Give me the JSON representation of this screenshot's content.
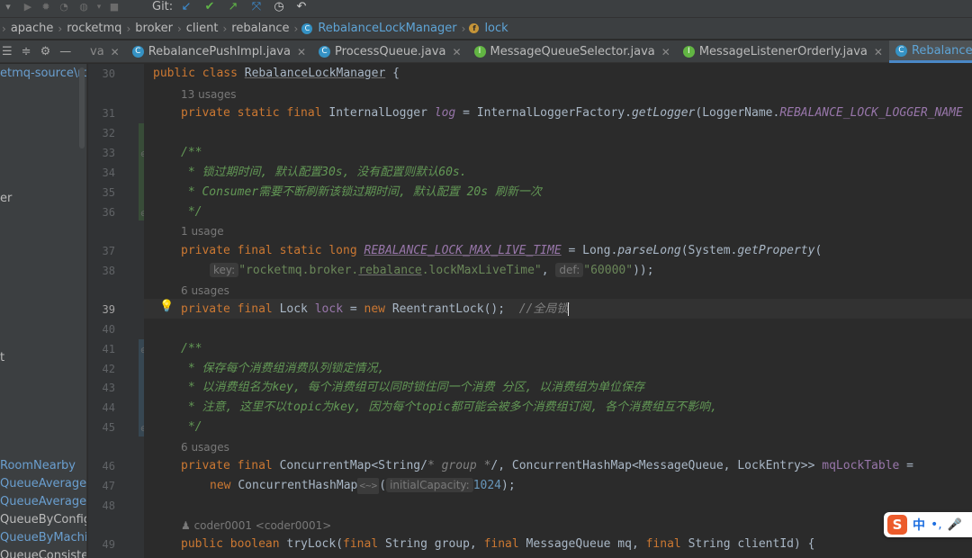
{
  "toolbar": {
    "git_label": "Git:"
  },
  "breadcrumb": {
    "items": [
      "apache",
      "rocketmq",
      "broker",
      "client",
      "rebalance"
    ],
    "class_name": "RebalanceLockManager",
    "member": "lock"
  },
  "sidebar_tools": {
    "partial_tab": "va"
  },
  "tabs": [
    {
      "label": "RebalancePushImpl.java",
      "icon": "class-icon",
      "active": false
    },
    {
      "label": "ProcessQueue.java",
      "icon": "class-icon",
      "active": false
    },
    {
      "label": "MessageQueueSelector.java",
      "icon": "interface-icon",
      "active": false
    },
    {
      "label": "MessageListenerOrderly.java",
      "icon": "interface-icon",
      "active": false
    },
    {
      "label": "RebalanceLockManager.j",
      "icon": "class-icon",
      "active": true
    }
  ],
  "sidebar": {
    "items": [
      {
        "text": "etmq-source\\roc"
      },
      {
        "text": "er"
      },
      {
        "text": "t"
      },
      {
        "text": "RoomNearby"
      },
      {
        "text": "QueueAveragely"
      },
      {
        "text": "QueueAveragelyI"
      },
      {
        "text": "QueueByConfig"
      },
      {
        "text": "QueueByMachine"
      },
      {
        "text": "QueueConsistent"
      }
    ]
  },
  "gutter": {
    "line_numbers": [
      "30",
      "31",
      "32",
      "33",
      "34",
      "35",
      "36",
      "37",
      "38",
      "39",
      "40",
      "41",
      "42",
      "43",
      "44",
      "45",
      "46",
      "47",
      "48",
      "49"
    ]
  },
  "code": {
    "l30": {
      "kw": "public class ",
      "name": "RebalanceLockManager",
      "rest": " {"
    },
    "u31": "13 usages",
    "l31": {
      "kw": "private static final ",
      "type": "InternalLogger ",
      "field": "log",
      "eq": " = InternalLoggerFactory.",
      "meth": "getLogger",
      "rest": "(LoggerName.",
      "const": "REBALANCE_LOCK_LOGGER_NAME"
    },
    "l33": "/**",
    "l34": " * 锁过期时间, 默认配置30s, 没有配置则默认60s.",
    "l35": " * Consumer需要不断刷新该锁过期时间, 默认配置 20s 刷新一次",
    "l36": " */",
    "u37": "1 usage",
    "l37": {
      "kw": "private final static long ",
      "const": "REBALANCE_LOCK_MAX_LIVE_TIME",
      "eq": " = Long.",
      "meth": "parseLong",
      "rest1": "(System.",
      "meth2": "getProperty",
      "rest2": "("
    },
    "l38": {
      "hint1": "key:",
      "str1a": "\"rocketmq.broker.",
      "str1b": "rebalance",
      "str1c": ".lockMaxLiveTime\"",
      "comma": ", ",
      "hint2": "def:",
      "str2": "\"60000\"",
      "end": "));"
    },
    "u39": "6 usages",
    "l39": {
      "kw": "private final ",
      "type": "Lock ",
      "field": "lock",
      "eq": " = ",
      "kw2": "new ",
      "rest": "ReentrantLock();  ",
      "cm": "//全局锁"
    },
    "l41": "/**",
    "l42": " * 保存每个消费组消费队列锁定情况,",
    "l43": " * 以消费组名为key, 每个消费组可以同时锁住同一个消费 分区, 以消费组为单位保存",
    "l44": " * 注意, 这里不以topic为key, 因为每个topic都可能会被多个消费组订阅, 各个消费组互不影响,",
    "l45": " */",
    "u46": "6 usages",
    "l46": {
      "kw": "private final ",
      "type": "ConcurrentMap<String/",
      "cm": "* group *",
      "rest": "/, ConcurrentHashMap<MessageQueue, LockEntry>> ",
      "field": "mqLockTable",
      "eq": " ="
    },
    "l47": {
      "kw": "new ",
      "type": "ConcurrentHashMap",
      "diamond": "<~>",
      "paren": "(",
      "hint": "initialCapacity:",
      "num": "1024",
      "end": ");"
    },
    "author": "coder0001 <coder0001>",
    "l49": {
      "kw": "public boolean ",
      "meth": "tryLock",
      "p1": "(",
      "kw2": "final ",
      "t1": "String group, ",
      "kw3": "final ",
      "t2": "MessageQueue mq, ",
      "kw4": "final ",
      "t3": "String clientId) {"
    }
  },
  "ime": {
    "logo": "S",
    "mode": "中",
    "punct": "•,"
  },
  "colors": {
    "background": "#2b2b2b",
    "keyword": "#cc7832",
    "field": "#9876aa",
    "string": "#6a8759",
    "number": "#6897bb",
    "doc_comment": "#629755",
    "accent": "#4a88c7"
  }
}
